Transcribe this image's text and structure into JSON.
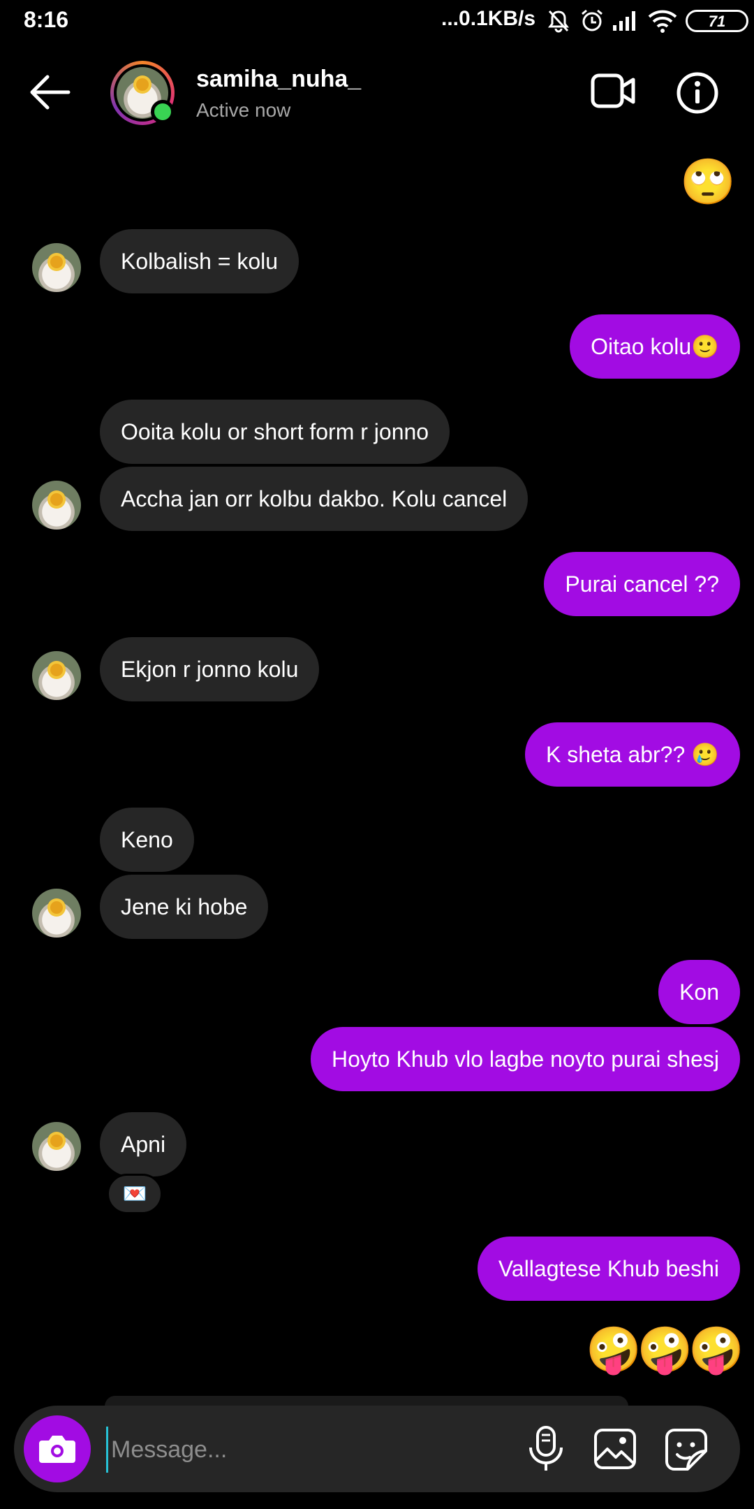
{
  "status_bar": {
    "time": "8:16",
    "network_speed": "...0.1KB/s",
    "battery": "71",
    "icons": [
      "mute-icon",
      "alarm-icon",
      "signal-icon",
      "wifi-icon",
      "battery-icon"
    ]
  },
  "header": {
    "username": "samiha_nuha_",
    "status": "Active now",
    "icons": [
      "back-arrow-icon",
      "video-call-icon",
      "info-icon"
    ]
  },
  "messages": [
    {
      "side": "out",
      "emoji": "🙄"
    },
    {
      "side": "in",
      "text": "Kolbalish = kolu"
    },
    {
      "side": "out",
      "text": "Oitao kolu🙂"
    },
    {
      "side": "in",
      "text": "Ooita kolu or short form r jonno"
    },
    {
      "side": "in",
      "text": "Accha jan orr kolbu dakbo. Kolu cancel"
    },
    {
      "side": "out",
      "text": "Purai cancel ??"
    },
    {
      "side": "in",
      "text": "Ekjon r jonno kolu"
    },
    {
      "side": "out",
      "text": "K sheta abr?? 🥲"
    },
    {
      "side": "in",
      "text": "Keno"
    },
    {
      "side": "in",
      "text": "Jene ki hobe"
    },
    {
      "side": "out",
      "text": "Kon"
    },
    {
      "side": "out",
      "text": "Hoyto Khub vlo lagbe noyto purai shesj"
    },
    {
      "side": "in",
      "text": "Apni",
      "reaction": "💌"
    },
    {
      "side": "out",
      "text": "Vallagtese Khub beshi"
    },
    {
      "side": "out",
      "emoji": "🤪🤪🤪"
    }
  ],
  "composer": {
    "placeholder": "Message...",
    "icons": [
      "camera-icon",
      "microphone-icon",
      "gallery-icon",
      "sticker-icon"
    ]
  },
  "colors": {
    "background": "#000000",
    "incoming_bubble": "#262626",
    "outgoing_bubble": "#a20ce3",
    "online": "#39d353"
  }
}
